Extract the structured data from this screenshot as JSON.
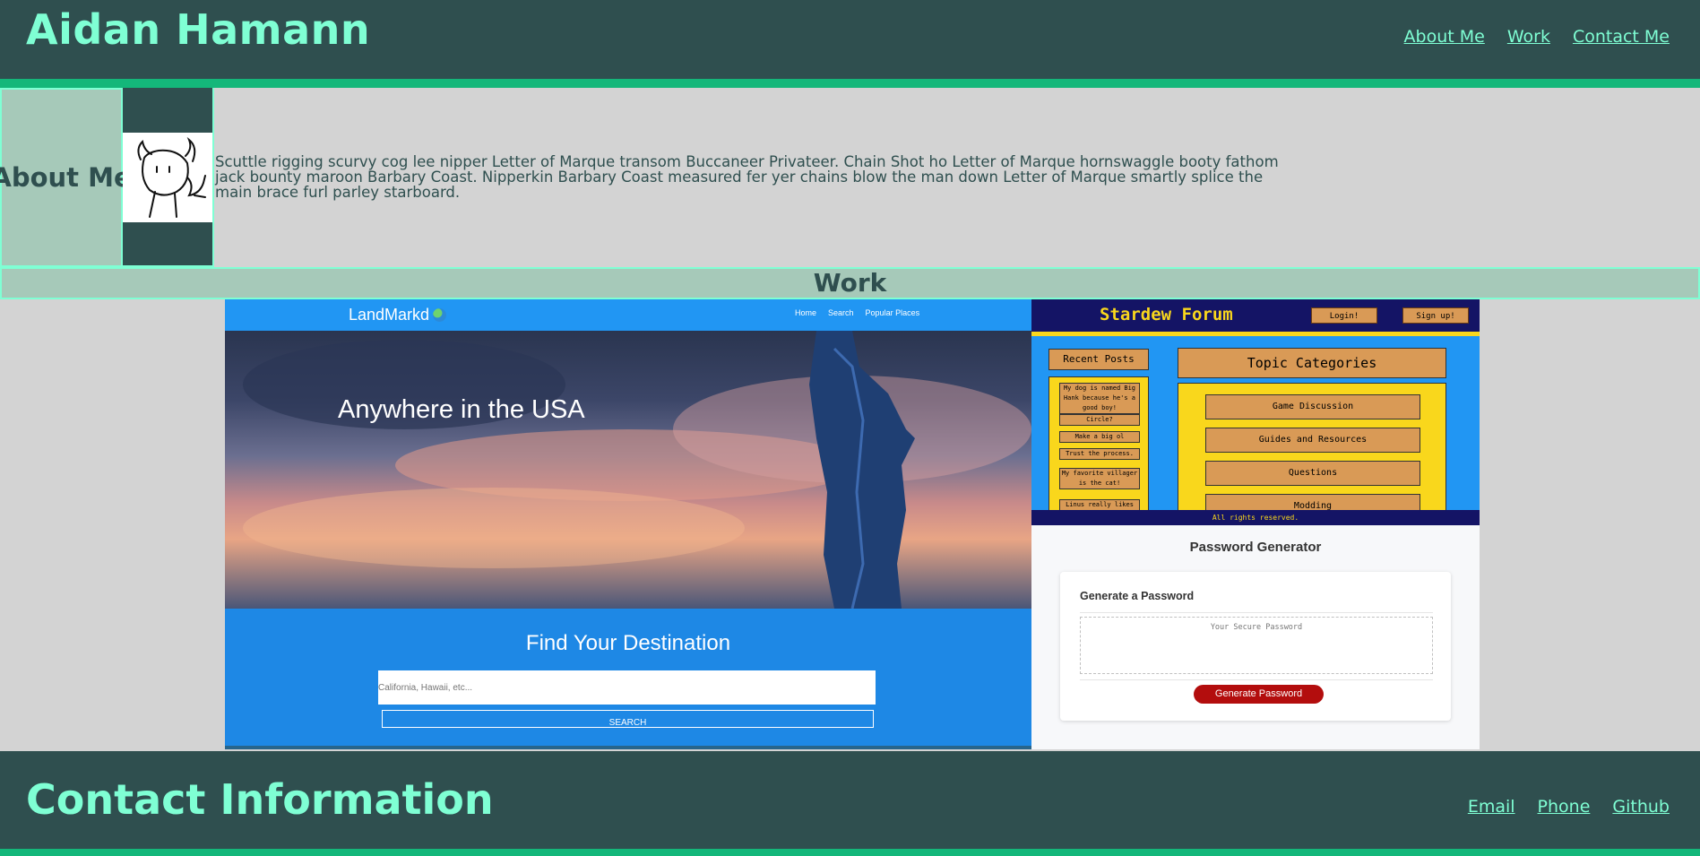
{
  "header": {
    "title": "Aidan Hamann",
    "nav": [
      "About Me",
      "Work",
      "Contact Me"
    ]
  },
  "about": {
    "heading": "About Me",
    "avatar_icon": "cartoon-cow-avatar",
    "text": "Scuttle rigging scurvy cog lee nipper Letter of Marque transom Buccaneer Privateer. Chain Shot ho Letter of Marque hornswaggle booty fathom jack bounty maroon Barbary Coast. Nipperkin Barbary Coast measured fer yer chains blow the man down Letter of Marque smartly splice the main brace furl parley starboard."
  },
  "work": {
    "heading": "Work",
    "landmarkd": {
      "brand": "LandMarkd",
      "brand_icon": "globe-icon",
      "nav": [
        "Home",
        "Search",
        "Popular Places"
      ],
      "hero_text": "Anywhere in the USA",
      "find_heading": "Find Your Destination",
      "search_placeholder": "California, Hawaii, etc...",
      "search_button": "SEARCH"
    },
    "stardew": {
      "title": "Stardew Forum",
      "login": "Login!",
      "signup": "Sign up!",
      "recent_heading": "Recent Posts",
      "recent_posts": [
        "My dog is named Big Hank because he's a good boy!",
        "Circle?",
        "Make a big ol",
        "Trust the process.",
        "My favorite villager is the cat!",
        "Linus really likes"
      ],
      "topics_heading": "Topic Categories",
      "topics": [
        "Game Discussion",
        "Guides and Resources",
        "Questions",
        "Modding"
      ],
      "footer": "All rights reserved."
    },
    "password_generator": {
      "title": "Password Generator",
      "card_title": "Generate a Password",
      "placeholder": "Your Secure Password",
      "button": "Generate Password"
    }
  },
  "footer": {
    "title": "Contact Information",
    "nav": [
      "Email",
      "Phone",
      "Github"
    ]
  },
  "colors": {
    "dark": "#2f4f4f",
    "accent": "#7fffd4",
    "green_rule": "#14b77a",
    "panel": "#a6c9b9",
    "background": "#d3d3d3"
  }
}
